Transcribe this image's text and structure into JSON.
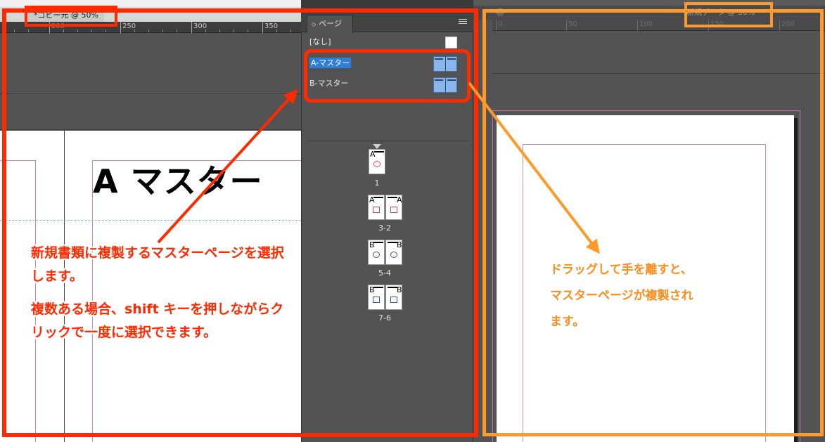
{
  "left_window": {
    "tab_title": "*コピー元 @ 50%",
    "ruler_labels": [
      "200",
      "250",
      "300",
      "350"
    ],
    "master_heading": "A マスター"
  },
  "pages_panel": {
    "tab_label": "ページ",
    "masters": [
      {
        "label": "[なし]",
        "selected": false
      },
      {
        "label": "A-マスター",
        "selected": true
      },
      {
        "label": "B-マスター",
        "selected": false
      }
    ],
    "pages": [
      {
        "label": "1",
        "left_letter": "A",
        "right_letter": ""
      },
      {
        "label": "3-2",
        "left_letter": "A",
        "right_letter": "A"
      },
      {
        "label": "5-4",
        "left_letter": "B",
        "right_letter": "B"
      },
      {
        "label": "7-6",
        "left_letter": "B",
        "right_letter": "B"
      }
    ]
  },
  "right_window": {
    "tab_title": "新規データ @ 50%",
    "ruler_labels": [
      "0",
      "50",
      "100",
      "150",
      "200"
    ]
  },
  "annotations": {
    "red_lines": [
      "新規書類に複製するマスターページを選択",
      "します。",
      "複数ある場合、shift キーを押しながらク",
      "リックで一度に選択できます。"
    ],
    "orange_lines": [
      "ドラッグして手を離すと、",
      "マスターページが複製され",
      "ます。"
    ],
    "colors": {
      "red": "#ff2a00",
      "orange": "#ff9a2a",
      "selection": "#2d7ed9"
    }
  }
}
